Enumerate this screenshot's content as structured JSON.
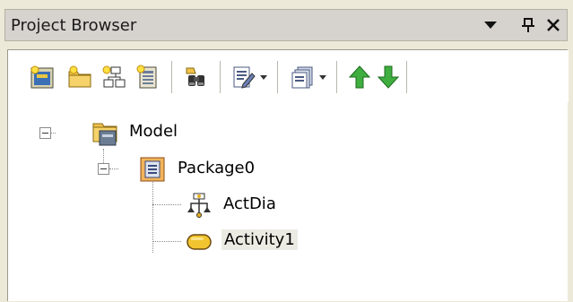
{
  "titlebar": {
    "title": "Project Browser"
  },
  "toolbar": {
    "buttons": [
      {
        "icon": "new-model-icon"
      },
      {
        "icon": "new-package-icon"
      },
      {
        "icon": "new-diagram-icon"
      },
      {
        "icon": "new-element-icon"
      },
      {
        "icon": "find-binoculars-icon"
      },
      {
        "icon": "edit-document-icon",
        "dropdown": true
      },
      {
        "icon": "documentation-icon",
        "dropdown": true
      },
      {
        "icon": "move-up-icon"
      },
      {
        "icon": "move-down-icon"
      }
    ]
  },
  "tree": {
    "nodes": [
      {
        "label": "Model",
        "icon": "model-icon",
        "expanded": true
      },
      {
        "label": "Package0",
        "icon": "package-icon",
        "expanded": true
      },
      {
        "label": "ActDia",
        "icon": "activity-diagram-icon"
      },
      {
        "label": "Activity1",
        "icon": "activity-icon",
        "selected": true
      }
    ]
  },
  "colors": {
    "window_bg": "#ece9d8",
    "titlebar_bg": "#d6d3ce",
    "selection_bg": "#ecebe3",
    "arrow_green": "#2f9a2f"
  }
}
